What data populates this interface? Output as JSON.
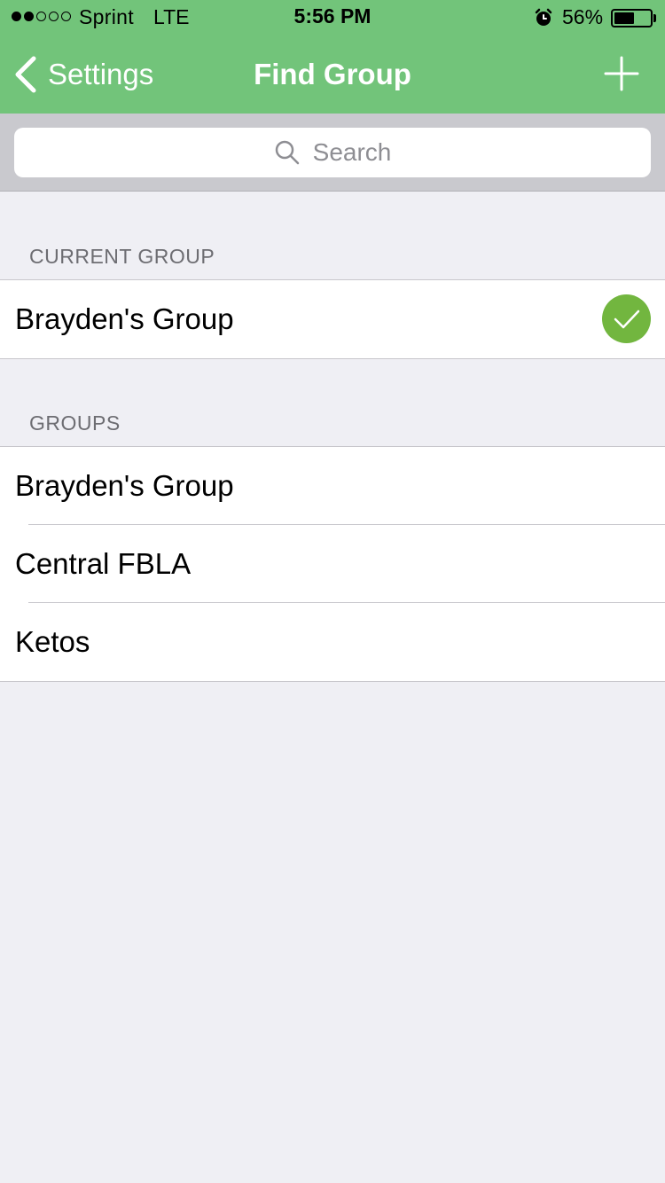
{
  "status_bar": {
    "carrier": "Sprint",
    "network": "LTE",
    "time": "5:56 PM",
    "battery_percent": "56%",
    "battery_level": 0.56,
    "signal_bars_filled": 2,
    "signal_bars_total": 5
  },
  "nav": {
    "back_label": "Settings",
    "title": "Find Group",
    "add_icon": "plus-icon"
  },
  "search": {
    "placeholder": "Search"
  },
  "current_group": {
    "header": "CURRENT GROUP",
    "name": "Brayden's Group",
    "selected_icon": "checkmark-icon"
  },
  "groups": {
    "header": "GROUPS",
    "items": [
      {
        "label": "Brayden's Group"
      },
      {
        "label": "Central FBLA"
      },
      {
        "label": "Ketos"
      }
    ]
  },
  "colors": {
    "nav_green": "#72c47a",
    "check_green": "#72b63f",
    "background": "#efeff4"
  }
}
